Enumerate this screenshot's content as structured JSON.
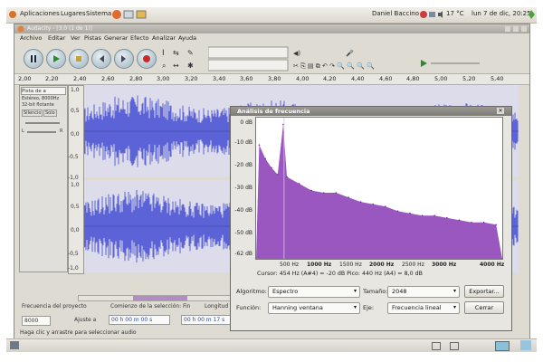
{
  "panel": {
    "menus": [
      "Aplicaciones",
      "Lugares",
      "Sistema"
    ],
    "user": "Daniel Baccino",
    "temperature": "17 °C",
    "clock": "lun 7 de dic, 20:25"
  },
  "window": {
    "title": "Audacity - [3.0 (1 de 1)]",
    "menu": [
      "Archivo",
      "Editar",
      "Ver",
      "Pistas",
      "Generar",
      "Efecto",
      "Analizar",
      "Ayuda"
    ]
  },
  "ruler": {
    "ticks": [
      "2,00",
      "2,20",
      "2,40",
      "2,60",
      "2,80",
      "3,00",
      "3,20",
      "3,40",
      "3,60",
      "3,80",
      "4,00",
      "4,20",
      "4,40",
      "4,60",
      "4,80",
      "5,00",
      "5,20",
      "5,40"
    ]
  },
  "track": {
    "name": "Pista de a",
    "info1": "Estéreo, 8000Hz",
    "info2": "32-bit flotante",
    "mute": "Silencio",
    "solo": "Solo",
    "left": "L",
    "right": "R",
    "scale_top": [
      "1,0",
      "0,5",
      "0,0",
      "-0,5",
      "-1,0"
    ],
    "scale_bottom": [
      "1,0",
      "0,5",
      "0,0",
      "-0,5",
      "-1,0"
    ]
  },
  "bottom_bar": {
    "rate_label": "Frecuencia del proyecto",
    "rate_value": "8000",
    "snap_label": "Ajuste a",
    "selection_start_label": "Comienzo de la selección:",
    "end_label": "Fin",
    "length_label": "Longitud",
    "time1": "00 h 00 m 00 s",
    "time2": "00 h 00 m 17 s"
  },
  "status": "Haga clic y arrastre para seleccionar audio",
  "dialog": {
    "title": "Análisis de frecuencia",
    "y_axis": [
      "0 dB",
      "-10 dB",
      "-20 dB",
      "-30 dB",
      "-40 dB",
      "-50 dB",
      "-62 dB"
    ],
    "x_axis": [
      "500 Hz",
      "1000 Hz",
      "1500 Hz",
      "2000 Hz",
      "2500 Hz",
      "3000 Hz",
      "4000 Hz"
    ],
    "cursor_info": "Cursor: 454 Hz (A#4) = -20 dB   Pico: 440 Hz (A4) = 8,0 dB",
    "algorithm_label": "Algoritmo:",
    "algorithm_value": "Espectro",
    "size_label": "Tamaño:",
    "size_value": "2048",
    "export_button": "Exportar...",
    "function_label": "Función:",
    "function_value": "Hanning ventana",
    "axis_label": "Eje:",
    "axis_value": "Frecuencia lineal",
    "close_button": "Cerrar"
  },
  "chart_data": {
    "type": "area",
    "title": "Análisis de frecuencia",
    "xlabel": "",
    "ylabel": "",
    "x": [
      50,
      150,
      250,
      350,
      440,
      500,
      700,
      900,
      1100,
      1300,
      1500,
      1700,
      1900,
      2100,
      2300,
      2500,
      2700,
      2900,
      3100,
      3300,
      3500,
      3700,
      3900,
      4000
    ],
    "y": [
      -12,
      -18,
      -22,
      -25,
      -3,
      -26,
      -29,
      -32,
      -33,
      -33,
      -35,
      -37,
      -38,
      -39,
      -41,
      -42,
      -43,
      -43,
      -44,
      -45,
      -46,
      -46,
      -47,
      -62
    ],
    "xlim": [
      0,
      4000
    ],
    "ylim": [
      -62,
      0
    ],
    "color": "#9a57c0"
  }
}
